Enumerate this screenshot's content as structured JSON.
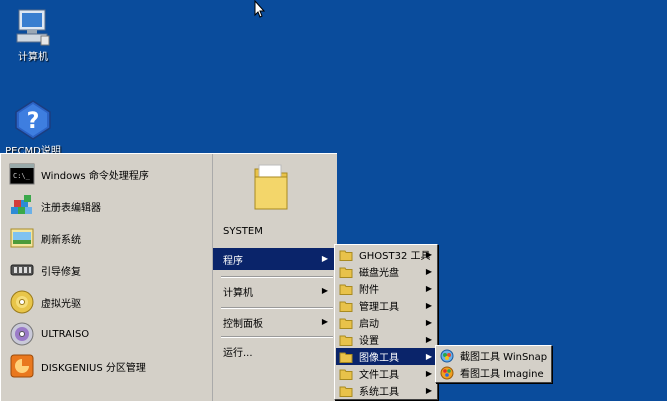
{
  "desktop": {
    "icons": [
      {
        "label": "计算机"
      },
      {
        "label": "PECMD说明"
      }
    ]
  },
  "start_menu": {
    "left_items": [
      {
        "label": "Windows 命令处理程序"
      },
      {
        "label": "注册表编辑器"
      },
      {
        "label": "刷新系统"
      },
      {
        "label": "引导修复"
      },
      {
        "label": "虚拟光驱"
      },
      {
        "label": "ULTRAISO"
      },
      {
        "label": "DISKGENIUS 分区管理"
      }
    ],
    "right_items": [
      {
        "label": "SYSTEM"
      },
      {
        "label": "程序"
      },
      {
        "label": "计算机"
      },
      {
        "label": "控制面板"
      },
      {
        "label": "运行..."
      }
    ]
  },
  "programs_menu": {
    "items": [
      {
        "label": "GHOST32 工具"
      },
      {
        "label": "磁盘光盘"
      },
      {
        "label": "附件"
      },
      {
        "label": "管理工具"
      },
      {
        "label": "启动"
      },
      {
        "label": "设置"
      },
      {
        "label": "图像工具"
      },
      {
        "label": "文件工具"
      },
      {
        "label": "系统工具"
      }
    ]
  },
  "image_tools_menu": {
    "items": [
      {
        "label": "截图工具 WinSnap"
      },
      {
        "label": "看图工具 Imagine"
      }
    ]
  },
  "colors": {
    "desktop_bg": "#0a4c9c",
    "menu_bg": "#d4d0c8",
    "highlight": "#0a246a"
  }
}
